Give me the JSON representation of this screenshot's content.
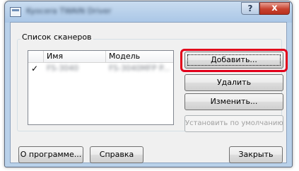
{
  "window": {
    "title": "Kyocera TWAIN Driver",
    "help_glyph": "?",
    "close_glyph": "x",
    "highlight_color": "#e2001a"
  },
  "scanners_group": {
    "label": "Список сканеров",
    "columns": [
      "Имя",
      "Модель"
    ],
    "rows": [
      {
        "checked": true,
        "check_glyph": "✓",
        "name": "FS-3040",
        "model": "FS-3040MFP P..."
      }
    ]
  },
  "buttons": {
    "add": "Добавить...",
    "delete": "Удалить",
    "edit": "Изменить...",
    "set_default": "Установить по умолчанию",
    "about": "О программе...",
    "help": "Справка",
    "close": "Закрыть"
  }
}
